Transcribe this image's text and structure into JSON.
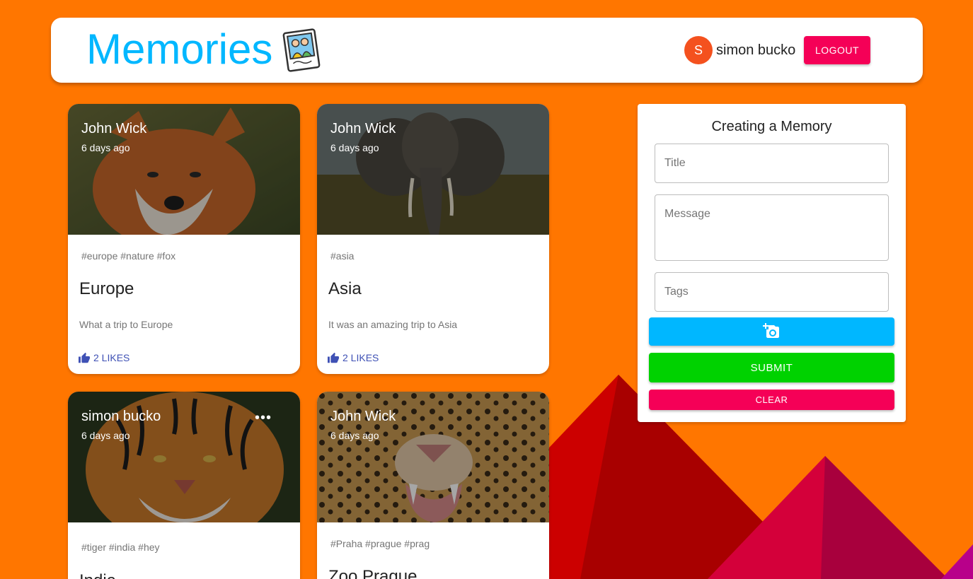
{
  "app": {
    "title": "Memories"
  },
  "user": {
    "initial": "S",
    "name": "simon bucko"
  },
  "header": {
    "logout_label": "LOGOUT"
  },
  "posts": [
    {
      "creator": "John Wick",
      "ago": "6 days ago",
      "tags": "#europe #nature #fox",
      "title": "Europe",
      "message": "What a trip to Europe",
      "likes": "2 LIKES",
      "image": "fox"
    },
    {
      "creator": "John Wick",
      "ago": "6 days ago",
      "tags": "#asia",
      "title": "Asia",
      "message": "It was an amazing trip to Asia",
      "likes": "2 LIKES",
      "image": "elephant"
    },
    {
      "creator": "simon bucko",
      "ago": "6 days ago",
      "tags": "#tiger #india #hey",
      "title": "India",
      "more": "•••",
      "image": "tiger"
    },
    {
      "creator": "John Wick",
      "ago": "6 days ago",
      "tags": "#Praha #prague #prag",
      "title": "Zoo Prague",
      "image": "leopard"
    }
  ],
  "form": {
    "heading": "Creating a Memory",
    "title_placeholder": "Title",
    "message_placeholder": "Message",
    "tags_placeholder": "Tags",
    "upload_icon": "add-photo-icon",
    "submit_label": "SUBMIT",
    "clear_label": "CLEAR"
  },
  "colors": {
    "background": "#ff7600",
    "brand": "#00b7ff",
    "logout": "#f50057",
    "submit": "#00d200",
    "upload": "#00b7ff",
    "likes": "#3f51b5"
  }
}
